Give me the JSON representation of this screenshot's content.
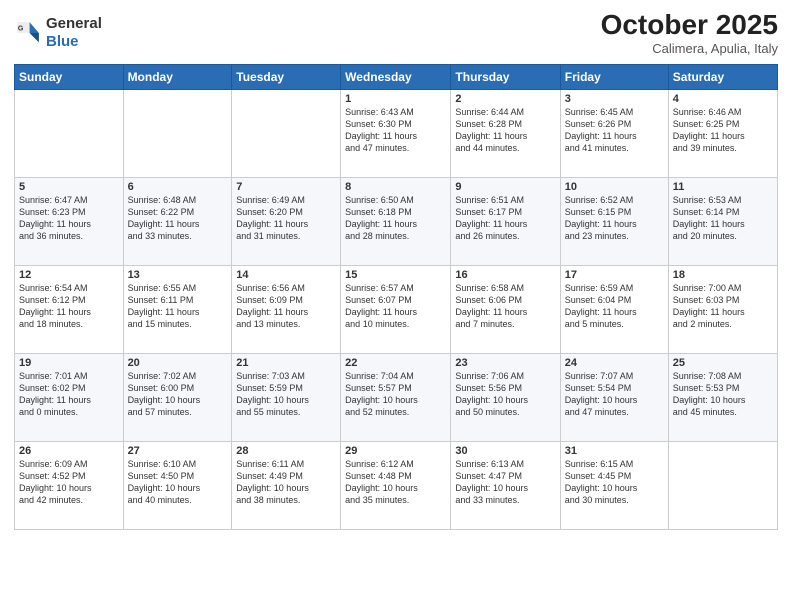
{
  "header": {
    "logo_general": "General",
    "logo_blue": "Blue",
    "month": "October 2025",
    "location": "Calimera, Apulia, Italy"
  },
  "weekdays": [
    "Sunday",
    "Monday",
    "Tuesday",
    "Wednesday",
    "Thursday",
    "Friday",
    "Saturday"
  ],
  "weeks": [
    [
      {
        "day": "",
        "info": ""
      },
      {
        "day": "",
        "info": ""
      },
      {
        "day": "",
        "info": ""
      },
      {
        "day": "1",
        "info": "Sunrise: 6:43 AM\nSunset: 6:30 PM\nDaylight: 11 hours\nand 47 minutes."
      },
      {
        "day": "2",
        "info": "Sunrise: 6:44 AM\nSunset: 6:28 PM\nDaylight: 11 hours\nand 44 minutes."
      },
      {
        "day": "3",
        "info": "Sunrise: 6:45 AM\nSunset: 6:26 PM\nDaylight: 11 hours\nand 41 minutes."
      },
      {
        "day": "4",
        "info": "Sunrise: 6:46 AM\nSunset: 6:25 PM\nDaylight: 11 hours\nand 39 minutes."
      }
    ],
    [
      {
        "day": "5",
        "info": "Sunrise: 6:47 AM\nSunset: 6:23 PM\nDaylight: 11 hours\nand 36 minutes."
      },
      {
        "day": "6",
        "info": "Sunrise: 6:48 AM\nSunset: 6:22 PM\nDaylight: 11 hours\nand 33 minutes."
      },
      {
        "day": "7",
        "info": "Sunrise: 6:49 AM\nSunset: 6:20 PM\nDaylight: 11 hours\nand 31 minutes."
      },
      {
        "day": "8",
        "info": "Sunrise: 6:50 AM\nSunset: 6:18 PM\nDaylight: 11 hours\nand 28 minutes."
      },
      {
        "day": "9",
        "info": "Sunrise: 6:51 AM\nSunset: 6:17 PM\nDaylight: 11 hours\nand 26 minutes."
      },
      {
        "day": "10",
        "info": "Sunrise: 6:52 AM\nSunset: 6:15 PM\nDaylight: 11 hours\nand 23 minutes."
      },
      {
        "day": "11",
        "info": "Sunrise: 6:53 AM\nSunset: 6:14 PM\nDaylight: 11 hours\nand 20 minutes."
      }
    ],
    [
      {
        "day": "12",
        "info": "Sunrise: 6:54 AM\nSunset: 6:12 PM\nDaylight: 11 hours\nand 18 minutes."
      },
      {
        "day": "13",
        "info": "Sunrise: 6:55 AM\nSunset: 6:11 PM\nDaylight: 11 hours\nand 15 minutes."
      },
      {
        "day": "14",
        "info": "Sunrise: 6:56 AM\nSunset: 6:09 PM\nDaylight: 11 hours\nand 13 minutes."
      },
      {
        "day": "15",
        "info": "Sunrise: 6:57 AM\nSunset: 6:07 PM\nDaylight: 11 hours\nand 10 minutes."
      },
      {
        "day": "16",
        "info": "Sunrise: 6:58 AM\nSunset: 6:06 PM\nDaylight: 11 hours\nand 7 minutes."
      },
      {
        "day": "17",
        "info": "Sunrise: 6:59 AM\nSunset: 6:04 PM\nDaylight: 11 hours\nand 5 minutes."
      },
      {
        "day": "18",
        "info": "Sunrise: 7:00 AM\nSunset: 6:03 PM\nDaylight: 11 hours\nand 2 minutes."
      }
    ],
    [
      {
        "day": "19",
        "info": "Sunrise: 7:01 AM\nSunset: 6:02 PM\nDaylight: 11 hours\nand 0 minutes."
      },
      {
        "day": "20",
        "info": "Sunrise: 7:02 AM\nSunset: 6:00 PM\nDaylight: 10 hours\nand 57 minutes."
      },
      {
        "day": "21",
        "info": "Sunrise: 7:03 AM\nSunset: 5:59 PM\nDaylight: 10 hours\nand 55 minutes."
      },
      {
        "day": "22",
        "info": "Sunrise: 7:04 AM\nSunset: 5:57 PM\nDaylight: 10 hours\nand 52 minutes."
      },
      {
        "day": "23",
        "info": "Sunrise: 7:06 AM\nSunset: 5:56 PM\nDaylight: 10 hours\nand 50 minutes."
      },
      {
        "day": "24",
        "info": "Sunrise: 7:07 AM\nSunset: 5:54 PM\nDaylight: 10 hours\nand 47 minutes."
      },
      {
        "day": "25",
        "info": "Sunrise: 7:08 AM\nSunset: 5:53 PM\nDaylight: 10 hours\nand 45 minutes."
      }
    ],
    [
      {
        "day": "26",
        "info": "Sunrise: 6:09 AM\nSunset: 4:52 PM\nDaylight: 10 hours\nand 42 minutes."
      },
      {
        "day": "27",
        "info": "Sunrise: 6:10 AM\nSunset: 4:50 PM\nDaylight: 10 hours\nand 40 minutes."
      },
      {
        "day": "28",
        "info": "Sunrise: 6:11 AM\nSunset: 4:49 PM\nDaylight: 10 hours\nand 38 minutes."
      },
      {
        "day": "29",
        "info": "Sunrise: 6:12 AM\nSunset: 4:48 PM\nDaylight: 10 hours\nand 35 minutes."
      },
      {
        "day": "30",
        "info": "Sunrise: 6:13 AM\nSunset: 4:47 PM\nDaylight: 10 hours\nand 33 minutes."
      },
      {
        "day": "31",
        "info": "Sunrise: 6:15 AM\nSunset: 4:45 PM\nDaylight: 10 hours\nand 30 minutes."
      },
      {
        "day": "",
        "info": ""
      }
    ]
  ]
}
